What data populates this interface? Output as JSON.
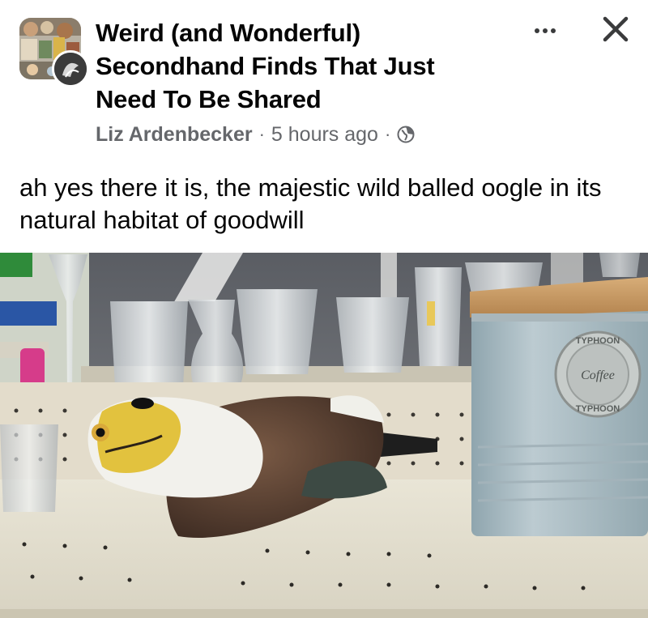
{
  "post": {
    "group_name": "Weird (and Wonderful) Secondhand Finds That Just Need To Be Shared",
    "author": "Liz Ardenbecker",
    "time_ago": "5 hours ago",
    "separator": "·",
    "privacy_icon": "globe-icon",
    "more_icon": "more-options-icon",
    "close_icon": "close-icon",
    "caption": "ah yes there it is, the majestic wild balled oogle in its natural habitat of goodwill"
  },
  "photo": {
    "canister_label_top": "TYPHOON",
    "canister_label_center": "Coffee",
    "canister_label_bottom": "TYPHOON"
  },
  "colors": {
    "text_primary": "#050505",
    "text_secondary": "#65676b",
    "background": "#ffffff"
  }
}
